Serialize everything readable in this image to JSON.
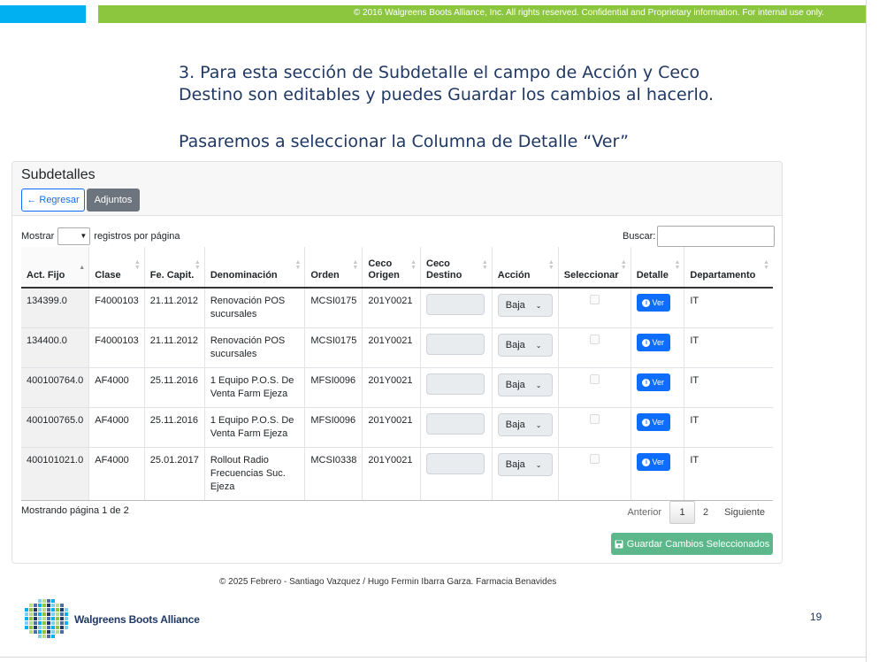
{
  "slide": {
    "copyright_banner": "© 2016 Walgreens Boots Alliance, Inc. All rights reserved. Confidential and Proprietary information. For internal use only.",
    "instruction_line1": "3. Para esta sección de Subdetalle el campo de Acción  y Ceco",
    "instruction_line2": "Destino son editables y puedes Guardar los cambios al hacerlo.",
    "instruction_line3": "Pasaremos a seleccionar la Columna de Detalle “Ver”",
    "credit": "© 2025 Febrero - Santiago Vazquez / Hugo Fermin Ibarra Garza. Farmacia Benavides",
    "brand": "Walgreens Boots Alliance",
    "page_number": "19"
  },
  "panel": {
    "title": "Subdetalles",
    "back_label": "Regresar",
    "attachments_label": "Adjuntos",
    "show_prefix": "Mostrar",
    "show_suffix": "registros por página",
    "search_label": "Buscar:",
    "footer_info": "Mostrando página 1 de 2",
    "save_label": "Guardar Cambios Seleccionados"
  },
  "table": {
    "columns": [
      "Act. Fijo",
      "Clase",
      "Fe. Capit.",
      "Denominación",
      "Orden",
      "Ceco Origen",
      "Ceco Destino",
      "Acción",
      "Seleccionar",
      "Detalle",
      "Departamento"
    ],
    "rows": [
      {
        "act": "134399.0",
        "clase": "F4000103",
        "fecha": "21.11.2012",
        "denom": "Renovación POS sucursales",
        "orden": "MCSI0175",
        "ceco": "201Y0021",
        "accion": "Baja",
        "detalle": "Ver",
        "depto": "IT"
      },
      {
        "act": "134400.0",
        "clase": "F4000103",
        "fecha": "21.11.2012",
        "denom": "Renovación POS sucursales",
        "orden": "MCSI0175",
        "ceco": "201Y0021",
        "accion": "Baja",
        "detalle": "Ver",
        "depto": "IT"
      },
      {
        "act": "400100764.0",
        "clase": "AF4000",
        "fecha": "25.11.2016",
        "denom": "1 Equipo P.O.S. De Venta Farm Ejeza",
        "orden": "MFSI0096",
        "ceco": "201Y0021",
        "accion": "Baja",
        "detalle": "Ver",
        "depto": "IT"
      },
      {
        "act": "400100765.0",
        "clase": "AF4000",
        "fecha": "25.11.2016",
        "denom": "1 Equipo P.O.S. De Venta Farm Ejeza",
        "orden": "MFSI0096",
        "ceco": "201Y0021",
        "accion": "Baja",
        "detalle": "Ver",
        "depto": "IT"
      },
      {
        "act": "400101021.0",
        "clase": "AF4000",
        "fecha": "25.01.2017",
        "denom": "Rollout Radio Frecuencias Suc. Ejeza",
        "orden": "MCSI0338",
        "ceco": "201Y0021",
        "accion": "Baja",
        "detalle": "Ver",
        "depto": "IT"
      }
    ]
  },
  "pagination": {
    "prev": "Anterior",
    "pages": [
      "1",
      "2"
    ],
    "active": "1",
    "next": "Siguiente"
  },
  "colors": {
    "primary": "#0d6efd",
    "secondary": "#6c757d",
    "success": "#5cb88a",
    "banner_green": "#8cc63f",
    "banner_blue": "#00b0f0",
    "heading_navy": "#1f3864"
  }
}
